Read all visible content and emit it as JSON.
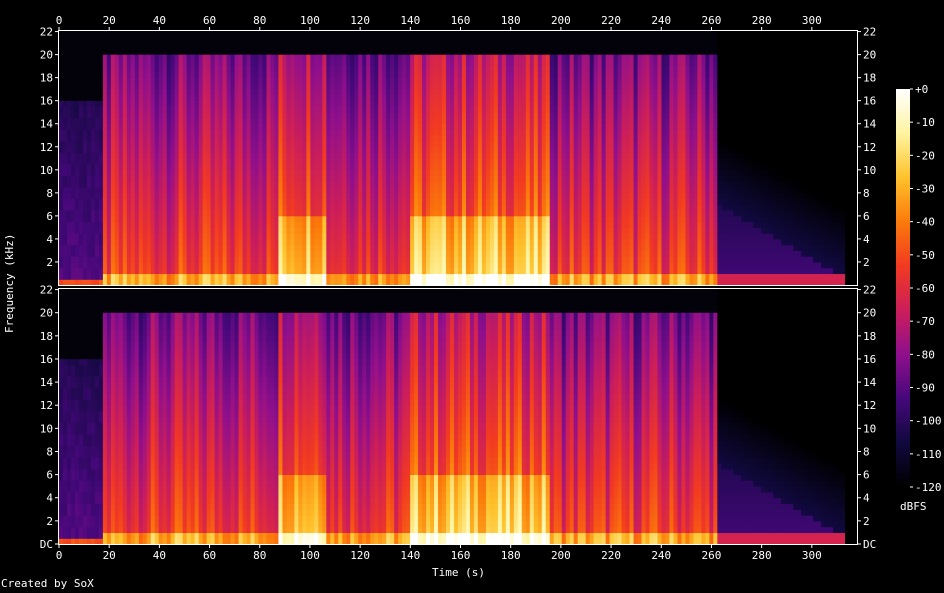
{
  "chart_data": {
    "type": "heatmap",
    "title": "",
    "credit": "Created by SoX",
    "xlabel": "Time (s)",
    "ylabel": "Frequency (kHz)",
    "colorbar_label": "dBFS",
    "x_ticks": [
      "0",
      "20",
      "40",
      "60",
      "80",
      "100",
      "120",
      "140",
      "160",
      "180",
      "200",
      "220",
      "240",
      "260",
      "280",
      "300"
    ],
    "y_ticks": [
      "DC",
      "2",
      "4",
      "6",
      "8",
      "10",
      "12",
      "14",
      "16",
      "18",
      "20",
      "22"
    ],
    "colorbar_ticks": [
      "+0",
      "-10",
      "-20",
      "-30",
      "-40",
      "-50",
      "-60",
      "-70",
      "-80",
      "-90",
      "-100",
      "-110",
      "-120"
    ],
    "xlim": [
      0,
      318
    ],
    "ylim": [
      0,
      22.05
    ],
    "clim": [
      -120,
      0
    ],
    "channels": 2,
    "audio_end_s": 313,
    "bandwidth_end_s": 262,
    "max_frequency_khz": 20,
    "loud_sections_s": [
      [
        88,
        107
      ],
      [
        140,
        196
      ]
    ],
    "quiet_sections_s": [
      [
        0,
        18
      ],
      [
        262,
        313
      ]
    ],
    "colormap": [
      "#000000",
      "#10093d",
      "#45087a",
      "#8f0f8c",
      "#cc1e5a",
      "#f23a21",
      "#fb7a0a",
      "#fec22c",
      "#fff4a0",
      "#ffffff"
    ]
  }
}
